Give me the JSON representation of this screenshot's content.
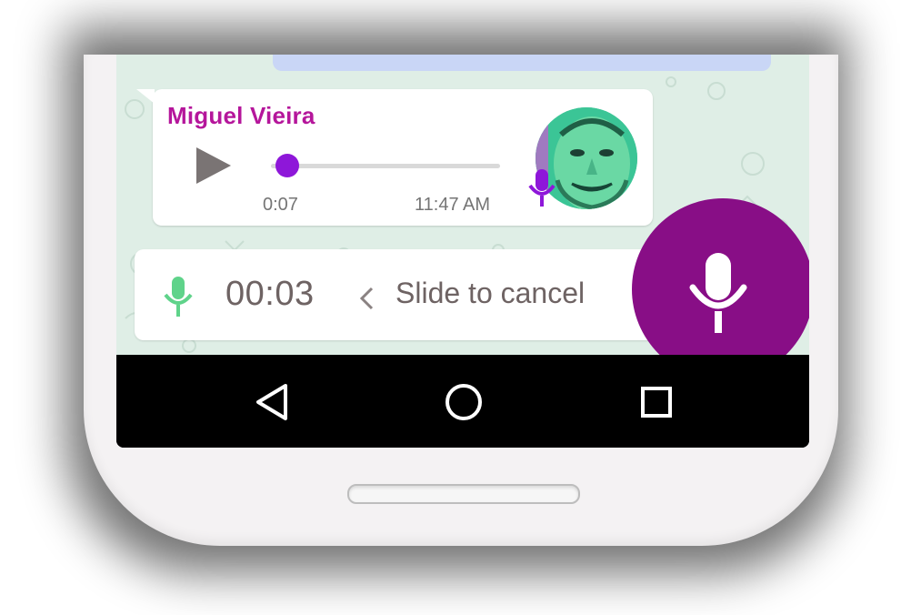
{
  "message": {
    "sender": "Miguel Vieira",
    "duration": "0:07",
    "timestamp": "11:47 AM",
    "playback_progress": 0.05,
    "avatar_icon": "contact-photo",
    "badge_icon": "mic-icon"
  },
  "recording": {
    "timer": "00:03",
    "slide_hint": "Slide to cancel",
    "hint_icon": "chevron-left-icon",
    "status_icon": "mic-icon"
  },
  "record_button": {
    "icon": "mic-icon"
  },
  "nav": {
    "back_icon": "back-icon",
    "home_icon": "home-icon",
    "recents_icon": "recents-icon"
  },
  "colors": {
    "sender": "#b5169b",
    "record_button": "#880e86",
    "progress_knob": "#8e17d9",
    "recording_mic": "#5fd38a",
    "chat_background": "#dfeee6"
  }
}
